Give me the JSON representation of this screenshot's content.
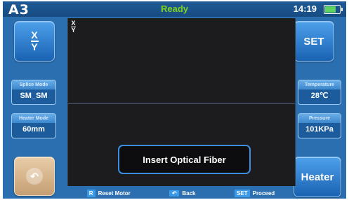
{
  "topbar": {
    "logo": "A3",
    "status": "Ready",
    "time": "14:19",
    "battery_level": 0.75,
    "status_color": "#7ed321"
  },
  "left": {
    "view_toggle": {
      "top": "X",
      "bottom": "Y"
    },
    "splice_mode": {
      "label": "Splice Mode",
      "value": "SM_SM"
    },
    "heater_mode": {
      "label": "Heater Mode",
      "value": "60mm"
    },
    "back_icon": "undo-arrow-icon"
  },
  "right": {
    "set_label": "SET",
    "temperature": {
      "label": "Temperature",
      "value": "28℃"
    },
    "pressure": {
      "label": "Pressure",
      "value": "101KPa"
    },
    "heater_label": "Heater"
  },
  "view": {
    "axis_top": "X",
    "axis_bottom": "Y",
    "message": "Insert Optical Fiber"
  },
  "footer": {
    "reset": {
      "key": "R",
      "label": "Reset Motor"
    },
    "back": {
      "key_icon": "undo-arrow-icon",
      "label": "Back"
    },
    "proceed": {
      "key": "SET",
      "label": "Proceed"
    }
  }
}
